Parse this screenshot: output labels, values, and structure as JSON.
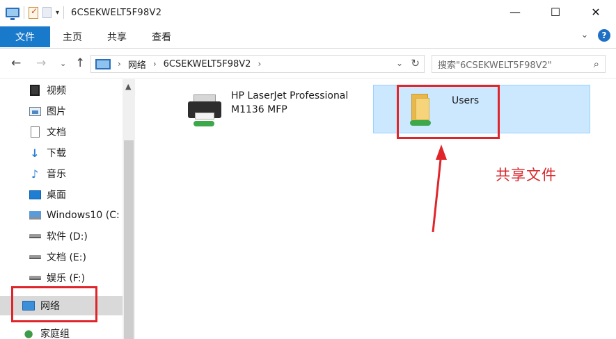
{
  "window": {
    "title": "6CSEKWELT5F98V2",
    "controls": {
      "minimize": "—",
      "maximize": "☐",
      "close": "✕"
    }
  },
  "ribbon": {
    "tabs": [
      {
        "label": "文件"
      },
      {
        "label": "主页"
      },
      {
        "label": "共享"
      },
      {
        "label": "查看"
      }
    ],
    "help": "?"
  },
  "navigation": {
    "breadcrumbs": [
      "网络",
      "6CSEKWELT5F98V2"
    ],
    "search_placeholder": "搜索\"6CSEKWELT5F98V2\""
  },
  "sidebar": {
    "items": [
      {
        "label": "视频",
        "icon": "video-icon"
      },
      {
        "label": "图片",
        "icon": "pictures-icon"
      },
      {
        "label": "文档",
        "icon": "documents-icon"
      },
      {
        "label": "下载",
        "icon": "download-icon"
      },
      {
        "label": "音乐",
        "icon": "music-icon"
      },
      {
        "label": "桌面",
        "icon": "desktop-icon"
      },
      {
        "label": "Windows10 (C:",
        "icon": "windows-drive-icon"
      },
      {
        "label": "软件 (D:)",
        "icon": "drive-icon"
      },
      {
        "label": "文档 (E:)",
        "icon": "drive-icon"
      },
      {
        "label": "娱乐 (F:)",
        "icon": "drive-icon"
      },
      {
        "label": "网络",
        "icon": "network-icon",
        "selected": true
      },
      {
        "label": "家庭组",
        "icon": "homegroup-icon"
      }
    ]
  },
  "content": {
    "items": [
      {
        "name": "HP LaserJet Professional M1136 MFP",
        "type": "printer"
      },
      {
        "name": "Users",
        "type": "shared-folder",
        "selected": true
      }
    ]
  },
  "annotation": {
    "text": "共享文件",
    "color": "#d8262a"
  },
  "colors": {
    "file_tab": "#1979ca",
    "selection": "#cce8ff",
    "highlight_box": "#e0252a"
  }
}
